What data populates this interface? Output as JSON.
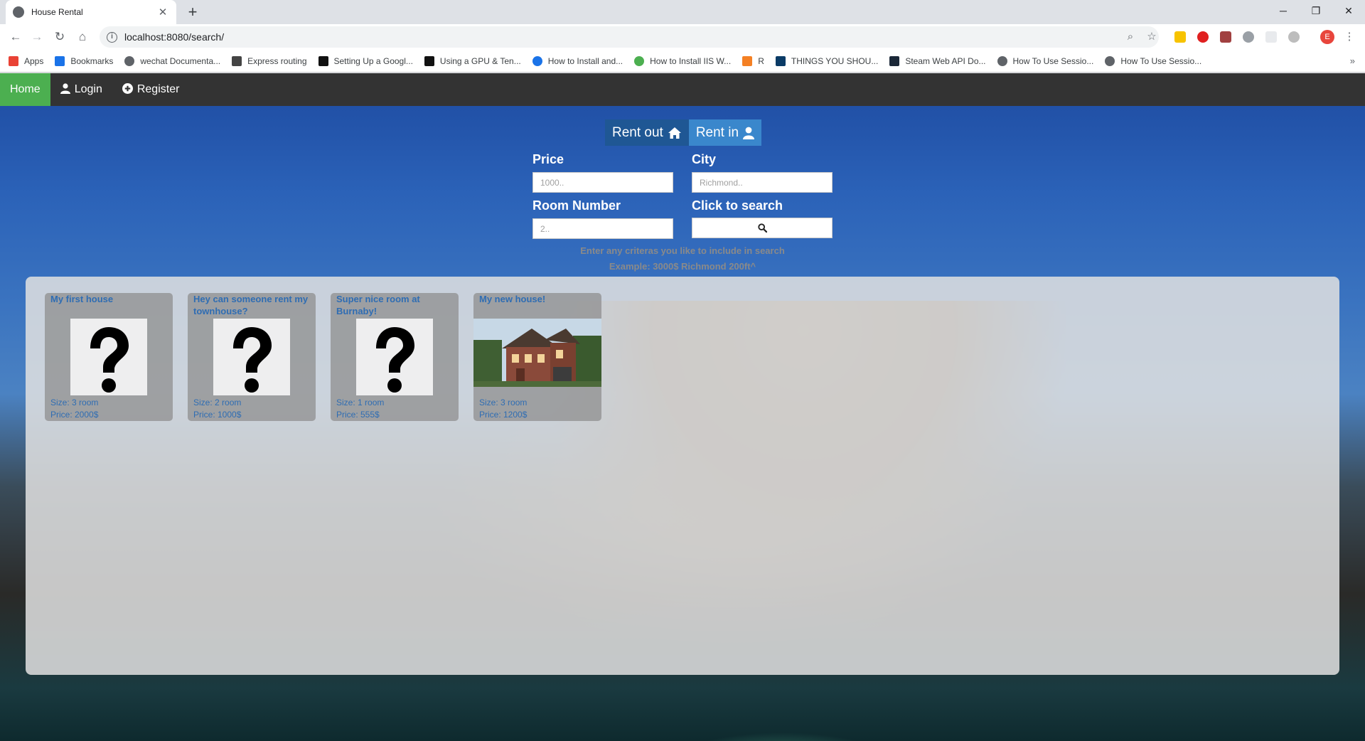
{
  "browser": {
    "tab_title": "House Rental",
    "tab_close": "✕",
    "new_tab": "+",
    "url": "localhost:8080/search/",
    "window_controls": {
      "minimize": "─",
      "restore": "❐",
      "close": "✕"
    },
    "bookmarks": [
      {
        "label": "Apps",
        "icon": "apps-grid-icon",
        "color": "#e94235"
      },
      {
        "label": "Bookmarks",
        "icon": "star-icon",
        "color": "#1a73e8"
      },
      {
        "label": "wechat Documenta...",
        "icon": "globe-icon",
        "color": "#5f6368"
      },
      {
        "label": "Express routing",
        "icon": "ex-icon",
        "color": "#444444"
      },
      {
        "label": "Setting Up a Googl...",
        "icon": "medium-icon",
        "color": "#111111"
      },
      {
        "label": "Using a GPU & Ten...",
        "icon": "medium-icon",
        "color": "#111111"
      },
      {
        "label": "How to Install and...",
        "icon": "refresh-logo-icon",
        "color": "#1a73e8"
      },
      {
        "label": "How to Install IIS W...",
        "icon": "green-dot-icon",
        "color": "#4caf50"
      },
      {
        "label": "R",
        "icon": "stack-icon",
        "color": "#f48024"
      },
      {
        "label": "THINGS YOU SHOU...",
        "icon": "jira-icon",
        "color": "#0a3b66"
      },
      {
        "label": "Steam Web API Do...",
        "icon": "checker-icon",
        "color": "#1b2838"
      },
      {
        "label": "How To Use Sessio...",
        "icon": "globe-icon",
        "color": "#5f6368"
      },
      {
        "label": "How To Use Sessio...",
        "icon": "globe-icon",
        "color": "#5f6368"
      }
    ],
    "bookmarks_more": "»",
    "profile_initial": "E"
  },
  "navbar": {
    "home": "Home",
    "login": "Login",
    "register": "Register",
    "active_color": "#4caf50"
  },
  "search": {
    "rent_out": "Rent out",
    "rent_in": "Rent in",
    "price_label": "Price",
    "price_placeholder": "1000..",
    "city_label": "City",
    "city_placeholder": "Richmond..",
    "room_label": "Room Number",
    "room_placeholder": "2..",
    "search_label": "Click to search",
    "hint_line1": "Enter any criteras you like to include in search",
    "hint_line2": "Example: 3000$ Richmond 200ft^"
  },
  "listings": [
    {
      "title": "My first house",
      "size": "Size: 3 room",
      "price": "Price: 2000$",
      "image": "question-mark"
    },
    {
      "title": "Hey can someone rent my townhouse?",
      "size": "Size: 2 room",
      "price": "Price: 1000$",
      "image": "question-mark"
    },
    {
      "title": "Super nice room at Burnaby!",
      "size": "Size: 1 room",
      "price": "Price: 555$",
      "image": "question-mark"
    },
    {
      "title": "My new house!",
      "size": "Size: 3 room",
      "price": "Price: 1200$",
      "image": "house-photo"
    }
  ]
}
